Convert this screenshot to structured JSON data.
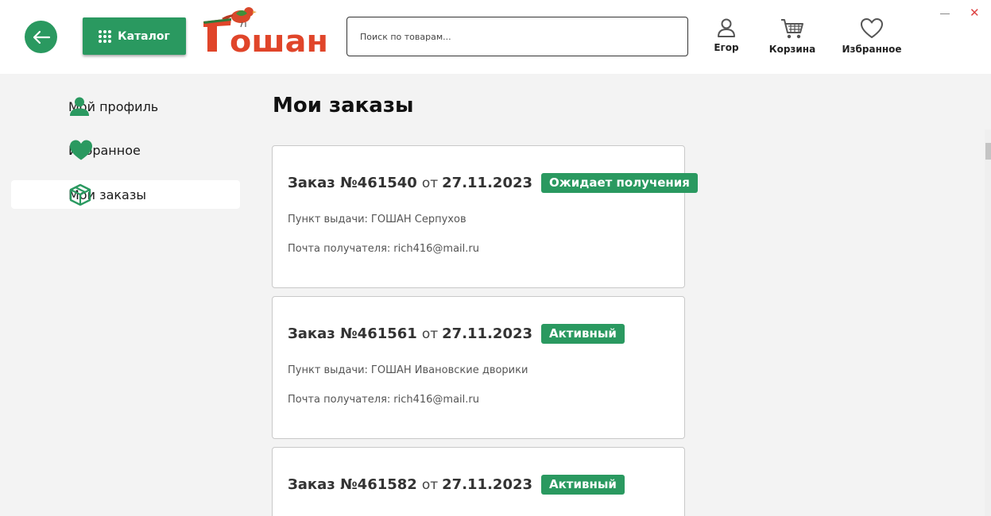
{
  "header": {
    "back_icon": "arrow-left-icon",
    "catalog_label": "Каталог",
    "logo_text": "ГОШАН",
    "search_placeholder": "Поиск по товарам...",
    "user_label": "Егор",
    "cart_label": "Корзина",
    "favorites_label": "Избранное"
  },
  "sidebar": {
    "items": [
      {
        "label": "Мой профиль",
        "icon": "user-icon"
      },
      {
        "label": "Избранное",
        "icon": "heart-icon"
      },
      {
        "label": "Мои заказы",
        "icon": "box-icon",
        "active": true
      }
    ]
  },
  "main": {
    "title": "Мои заказы",
    "orders": [
      {
        "number": "Заказ №461540",
        "from": "от",
        "date": "27.11.2023",
        "status": "Ожидает получения",
        "pickup_label": "Пункт выдачи:",
        "pickup": "ГОШАН Серпухов",
        "email_label": "Почта получателя:",
        "email": "rich416@mail.ru"
      },
      {
        "number": "Заказ №461561",
        "from": "от",
        "date": "27.11.2023",
        "status": "Активный",
        "pickup_label": "Пункт выдачи:",
        "pickup": "ГОШАН Ивановские дворики",
        "email_label": "Почта получателя:",
        "email": "rich416@mail.ru"
      },
      {
        "number": "Заказ №461582",
        "from": "от",
        "date": "27.11.2023",
        "status": "Активный"
      }
    ]
  },
  "colors": {
    "accent": "#2a9960",
    "logo_red": "#e0452a",
    "background": "#f3f3f3"
  }
}
